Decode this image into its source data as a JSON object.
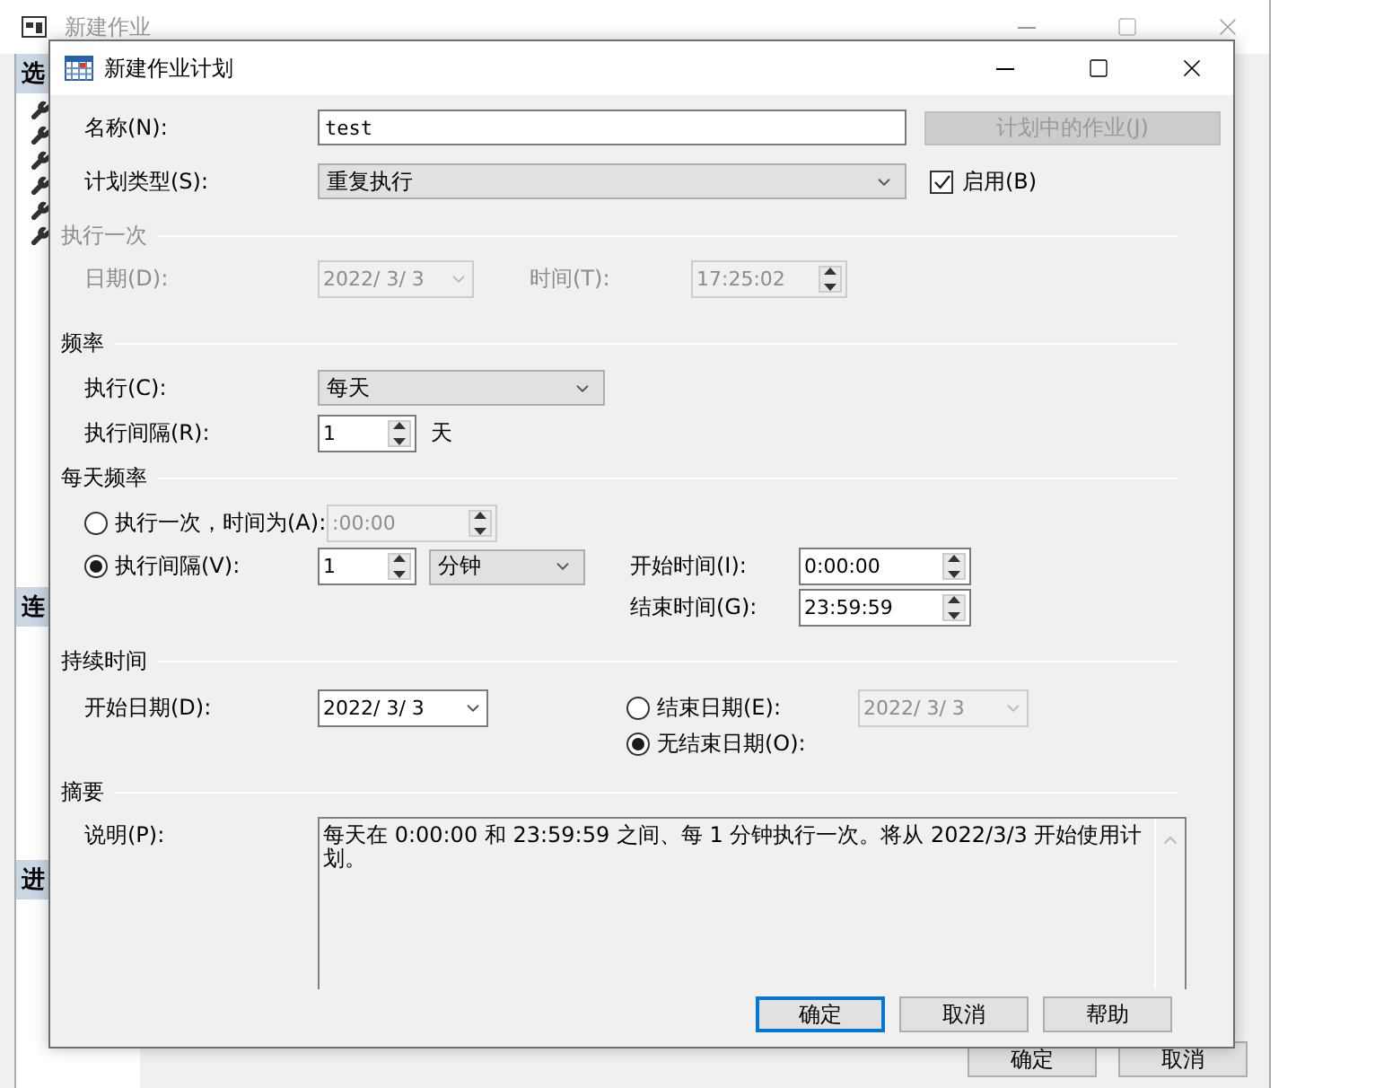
{
  "background_window": {
    "title": "新建作业",
    "sidebar_headers": [
      "选",
      "连",
      "进"
    ],
    "buttons": [
      "确定",
      "取消"
    ]
  },
  "dialog": {
    "title": "新建作业计划"
  },
  "name": {
    "label": "名称(N):",
    "value": "test"
  },
  "jobs_button": {
    "label": "计划中的作业(J)",
    "disabled": true
  },
  "schedule_type": {
    "label": "计划类型(S):",
    "value": "重复执行"
  },
  "enabled": {
    "label": "启用(B)",
    "checked": true
  },
  "one_time": {
    "title": "执行一次",
    "disabled": true,
    "date_label": "日期(D):",
    "date": "2022/ 3/ 3",
    "time_label": "时间(T):",
    "time": "17:25:02"
  },
  "frequency": {
    "title": "频率",
    "occurs_label": "执行(C):",
    "occurs": "每天",
    "recurs_label": "执行间隔(R):",
    "recurs": "1",
    "recurs_unit": "天"
  },
  "daily_frequency": {
    "title": "每天频率",
    "options": [
      {
        "kind": "once",
        "label": "执行一次，时间为(A):",
        "selected": false,
        "time": ":00:00"
      },
      {
        "kind": "interval",
        "label": "执行间隔(V):",
        "selected": true,
        "interval": "1",
        "unit": "分钟"
      }
    ],
    "start_label": "开始时间(I):",
    "start": "0:00:00",
    "end_label": "结束时间(G):",
    "end": "23:59:59"
  },
  "duration": {
    "title": "持续时间",
    "start_label": "开始日期(D):",
    "start": "2022/ 3/ 3",
    "end_options": [
      {
        "kind": "date",
        "label": "结束日期(E):",
        "selected": false,
        "date": "2022/ 3/ 3"
      },
      {
        "kind": "none",
        "label": "无结束日期(O):",
        "selected": true
      }
    ]
  },
  "summary": {
    "title": "摘要",
    "label": "说明(P):",
    "text": "每天在 0:00:00 和 23:59:59 之间、每 1 分钟执行一次。将从 2022/3/3 开始使用计划。"
  },
  "buttons": [
    {
      "label": "确定",
      "default": true
    },
    {
      "label": "取消",
      "default": false
    },
    {
      "label": "帮助",
      "default": false
    }
  ]
}
